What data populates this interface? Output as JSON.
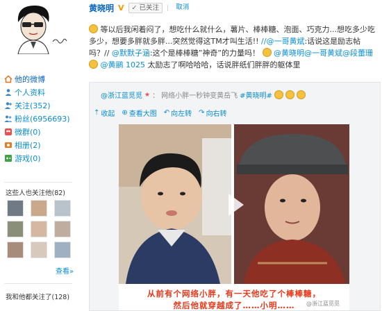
{
  "profile": {
    "name": "黄晓明",
    "follow_status": "已关注",
    "follow_divider": "|",
    "unfollow": "取消"
  },
  "sidebar": {
    "items": [
      {
        "label": "他的微博",
        "icon": "house-icon"
      },
      {
        "label": "个人资料",
        "icon": "person-icon"
      },
      {
        "label": "关注(352)",
        "icon": "follow-icon"
      },
      {
        "label": "粉丝(6956693)",
        "icon": "fans-icon"
      },
      {
        "label": "微群(0)",
        "icon": "group-icon"
      },
      {
        "label": "相册(2)",
        "icon": "album-icon"
      },
      {
        "label": "游戏(0)",
        "icon": "game-icon"
      }
    ],
    "also_follow_title": "这些人也关注他(82)",
    "more": "查看»",
    "mutual_title": "我和他都关注了(128)"
  },
  "post": {
    "line1": "等以后我闲着闷了，想吃什么就什么，薯片、棒棒糖、泡面、巧克力...想吃多少吃多",
    "line2": "少，想要多胖就多胖...突然觉得这TM才叫生活!!",
    "mention_a": "//@一哥黄斌",
    "mention_a_text": ":话说这是励志帖吗？//",
    "mention_b": "@默默子涵",
    "line3_text": ":这个是棒棒糖”神奇”的力量吗！",
    "mention_c": "@黄晓明",
    "mention_d": "@一哥黄斌",
    "mention_e": "@段蕾珊",
    "mention_f": "@黄鹂",
    "mention_f2": "1025",
    "line4_text": " 太励志了啊哈哈哈，话说胖纸们胖胖的躯体里"
  },
  "repost": {
    "source": "@浙江蓝觅觅",
    "source_suffix": "：",
    "text": "网络小胖一秒钟变黄岳飞",
    "tag": "#黄晓明#",
    "actions": [
      {
        "label": "收起",
        "icon": "collapse-icon"
      },
      {
        "label": "查看大图",
        "icon": "zoom-icon"
      },
      {
        "label": "向左转",
        "icon": "rotate-left-icon"
      },
      {
        "label": "向右转",
        "icon": "rotate-right-icon"
      }
    ],
    "caption1": "从前有个网络小胖，有一天他吃了个棒棒糖，",
    "caption2": "然后他就穿越成了……小明……",
    "watermark": "@浙江蓝觅觅"
  },
  "colors": {
    "link": "#0a8cd2",
    "caption": "#e8381b",
    "badge": "#f59a00"
  }
}
